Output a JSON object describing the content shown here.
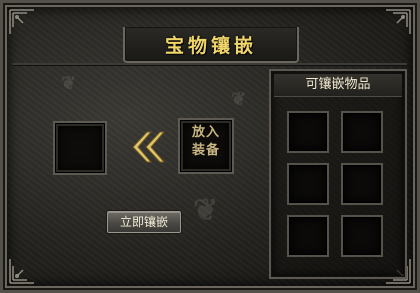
{
  "window": {
    "title": "宝物镶嵌"
  },
  "main": {
    "input_slot_label": "放入\n装备",
    "embed_button_label": "立即镶嵌"
  },
  "side_panel": {
    "header": "可镶嵌物品",
    "slot_count": 6
  },
  "colors": {
    "title_gold": "#f0d66a",
    "arrow_gold": "#e2c56a",
    "frame_stone": "#54514a"
  },
  "icons": {
    "arrow": "double-chevron-left-icon",
    "corners": "ornament-corner-icon"
  }
}
